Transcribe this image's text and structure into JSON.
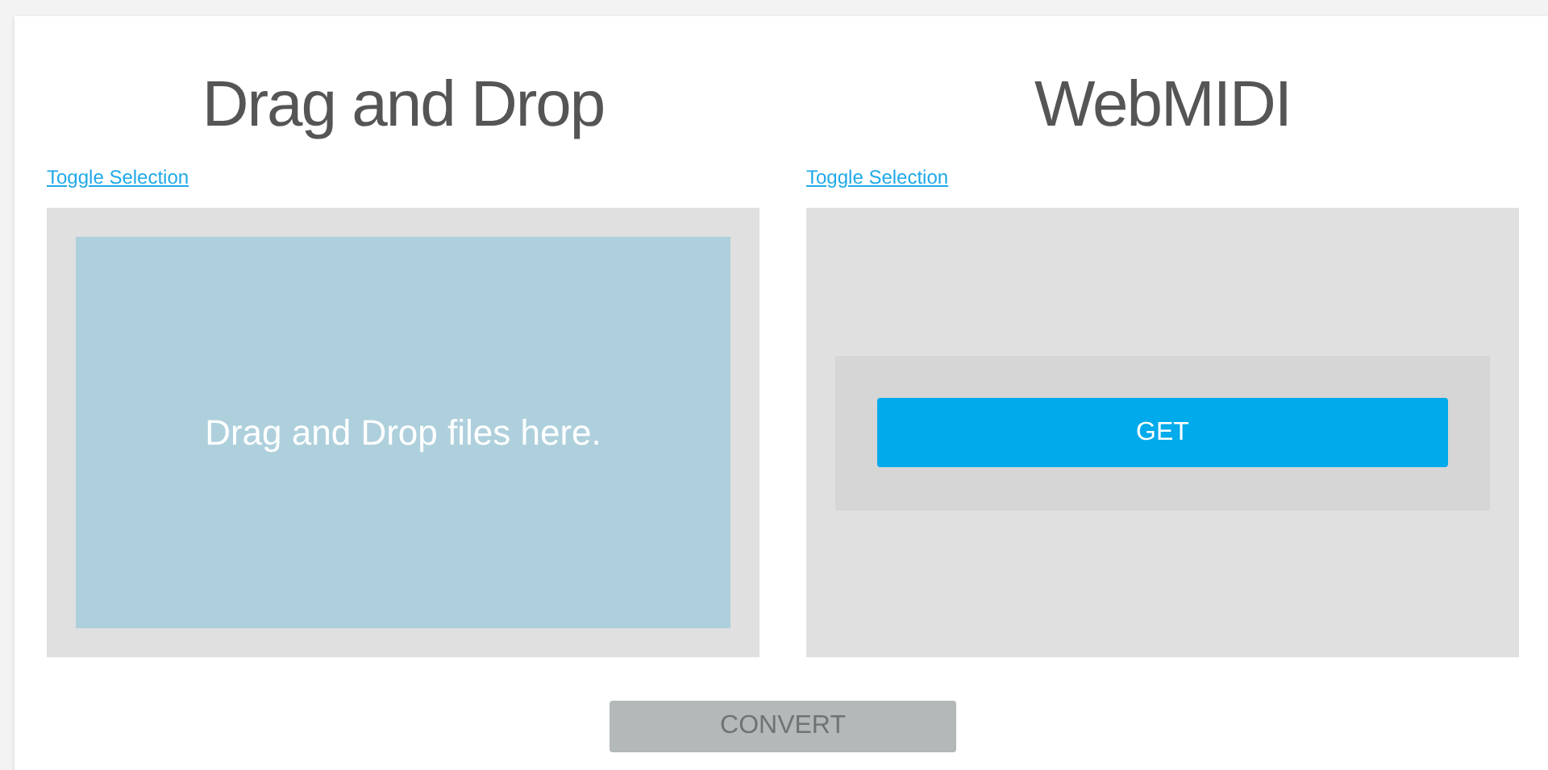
{
  "panels": [
    {
      "kind": "dropzone",
      "title": "Drag and Drop",
      "toggle_link": "Toggle Selection",
      "drop_text": "Drag and Drop files here."
    },
    {
      "kind": "midi",
      "title": "WebMIDI",
      "toggle_link": "Toggle Selection",
      "button": "GET"
    }
  ],
  "convert_button": {
    "label": "CONVERT",
    "disabled": true
  }
}
